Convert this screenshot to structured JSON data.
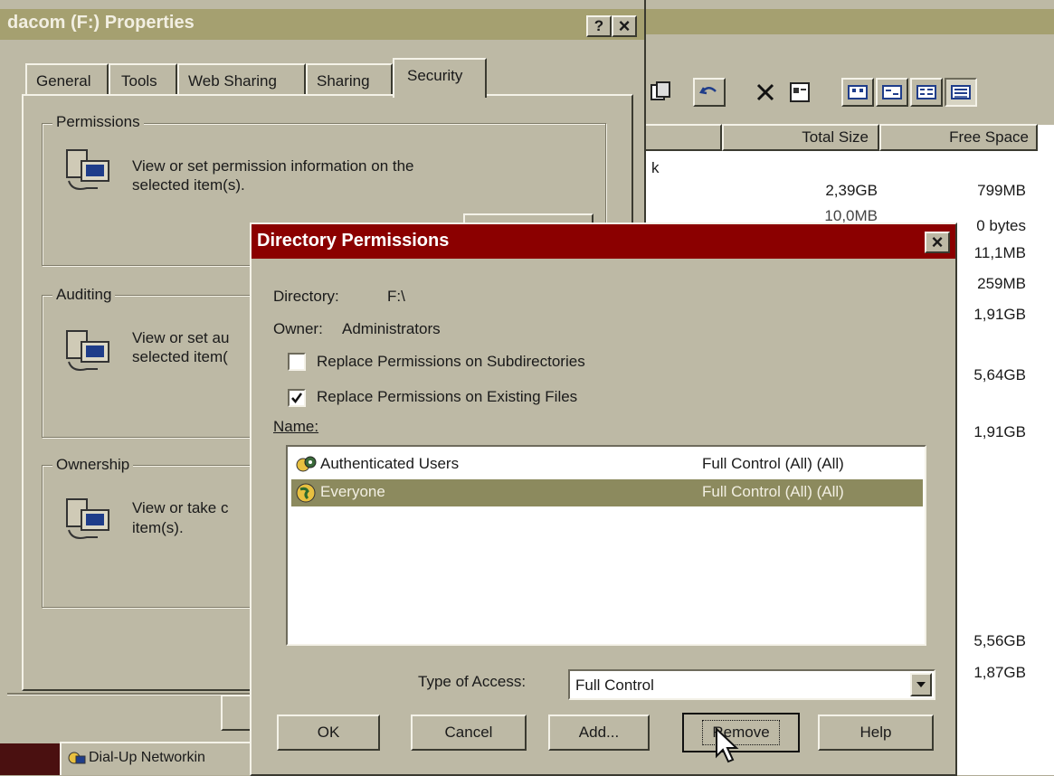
{
  "explorer": {
    "col_total": "Total Size",
    "col_free": "Free Space",
    "partial_char": "k",
    "total_sizes": [
      "2,39GB",
      "10,0MB"
    ],
    "free_space": [
      "799MB",
      "0 bytes",
      "11,1MB",
      "259MB",
      "1,91GB",
      "5,64GB",
      "1,91GB",
      "5,56GB",
      "1,87GB"
    ],
    "taskbar_item": "Dial-Up Networkin",
    "toolbar_icons": [
      "copy-icon",
      "undo-icon",
      "delete-icon",
      "properties-icon",
      "large-icons-view-icon",
      "small-icons-view-icon",
      "list-view-icon",
      "details-view-icon"
    ]
  },
  "properties": {
    "title": "dacom (F:) Properties",
    "help_btn": "?",
    "close_btn": "×",
    "tabs": [
      "General",
      "Tools",
      "Web Sharing",
      "Sharing",
      "Security"
    ],
    "permissions": {
      "legend": "Permissions",
      "text1": "View or set permission information on the",
      "text2": "selected item(s)."
    },
    "auditing": {
      "legend": "Auditing",
      "text1": "View or set au",
      "text2": "selected item("
    },
    "ownership": {
      "legend": "Ownership",
      "text1": "View or take c",
      "text2": "item(s)."
    }
  },
  "dialog": {
    "title": "Directory Permissions",
    "close_btn": "×",
    "directory_label": "Directory:",
    "directory_value": "F:\\",
    "owner_label": "Owner:",
    "owner_value": "Administrators",
    "replace_subdirs": {
      "label": "Replace Permissions on Subdirectories",
      "checked": false
    },
    "replace_files": {
      "label": "Replace Permissions on Existing Files",
      "checked": true
    },
    "name_label": "Name:",
    "entries": [
      {
        "name": "Authenticated Users",
        "access": "Full Control (All) (All)",
        "selected": false
      },
      {
        "name": "Everyone",
        "access": "Full Control (All) (All)",
        "selected": true
      }
    ],
    "type_of_access_label": "Type of Access:",
    "type_of_access_value": "Full Control",
    "buttons": {
      "ok": "OK",
      "cancel": "Cancel",
      "add": "Add...",
      "remove": "Remove",
      "help": "Help"
    }
  },
  "colors": {
    "desktop": "#b0ab96",
    "dialog_title": "#8b0000",
    "inactive_title": "#a5a070",
    "selection": "#8c8a5e"
  }
}
